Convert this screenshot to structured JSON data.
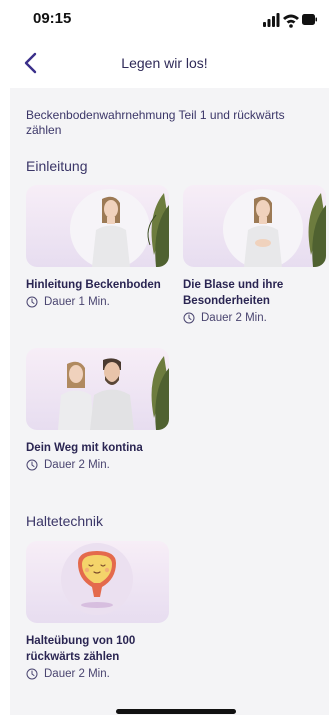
{
  "status": {
    "time": "09:15"
  },
  "header": {
    "title": "Legen wir los!"
  },
  "intro": "Beckenbodenwahrnehmung Teil 1 und rückwärts zählen",
  "sections": [
    {
      "title": "Einleitung",
      "items": [
        {
          "title": "Hinleitung Beckenboden",
          "duration": "Dauer 1 Min."
        },
        {
          "title": "Die Blase und ihre Besonderheiten",
          "duration": "Dauer 2 Min."
        },
        {
          "title": "Dein Weg mit kontina",
          "duration": "Dauer 2 Min."
        }
      ]
    },
    {
      "title": "Haltetechnik",
      "items": [
        {
          "title": "Halteübung von 100 rückwärts zählen",
          "duration": "Dauer 2 Min."
        }
      ]
    }
  ],
  "colors": {
    "accent": "#3a2f8a",
    "text": "#2f2a58",
    "background": "#f4f4f6"
  },
  "icons": [
    "back-chevron-icon",
    "clock-icon",
    "signal-icon",
    "wifi-icon",
    "battery-icon"
  ]
}
